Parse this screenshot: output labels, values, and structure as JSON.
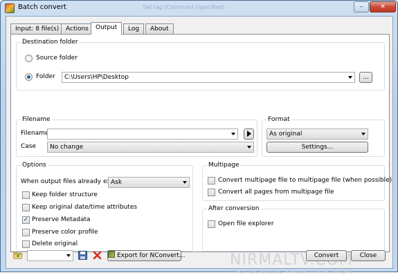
{
  "window": {
    "title": "Batch convert",
    "faded_title": "Set tag (Common) (specified)",
    "minimize_label": "–",
    "close_label": "✕"
  },
  "tabs": [
    {
      "label": "Input: 8 file(s)"
    },
    {
      "label": "Actions"
    },
    {
      "label": "Output"
    },
    {
      "label": "Log"
    },
    {
      "label": "About"
    }
  ],
  "destination": {
    "group_label": "Destination folder",
    "source_label": "Source folder",
    "folder_label": "Folder",
    "folder_value": "C:\\Users\\HP\\Desktop",
    "browse_label": "..."
  },
  "filename": {
    "group_label": "Filename",
    "name_label": "Filename",
    "name_value": "",
    "case_label": "Case",
    "case_value": "No change"
  },
  "format": {
    "group_label": "Format",
    "value": "As original",
    "settings_label": "Settings..."
  },
  "options": {
    "group_label": "Options",
    "exist_label": "When output files already exist",
    "exist_value": "Ask",
    "checks": [
      {
        "label": "Keep folder structure",
        "checked": false
      },
      {
        "label": "Keep original date/time attributes",
        "checked": false
      },
      {
        "label": "Preserve Metadata",
        "checked": true
      },
      {
        "label": "Preserve color profile",
        "checked": false
      },
      {
        "label": "Delete original",
        "checked": false
      }
    ]
  },
  "multipage": {
    "group_label": "Multipage",
    "checks": [
      {
        "label": "Convert multipage file to multipage file (when possible)",
        "checked": false
      },
      {
        "label": "Convert all pages from multipage file",
        "checked": false
      }
    ]
  },
  "after": {
    "group_label": "After conversion",
    "open_label": "Open file explorer"
  },
  "footer": {
    "preset_value": "",
    "export_label": "Export for NConvert...",
    "convert_label": "Convert",
    "close_label": "Close"
  },
  "watermark": {
    "main": "NIRMALTV.COM",
    "sub": "Tech Tips, Windows, Freeware, Internet, Gadgets"
  },
  "colors": {
    "accent": "#2b5e9c",
    "titlebar": "#b9d1ea",
    "close": "#c94a36"
  }
}
